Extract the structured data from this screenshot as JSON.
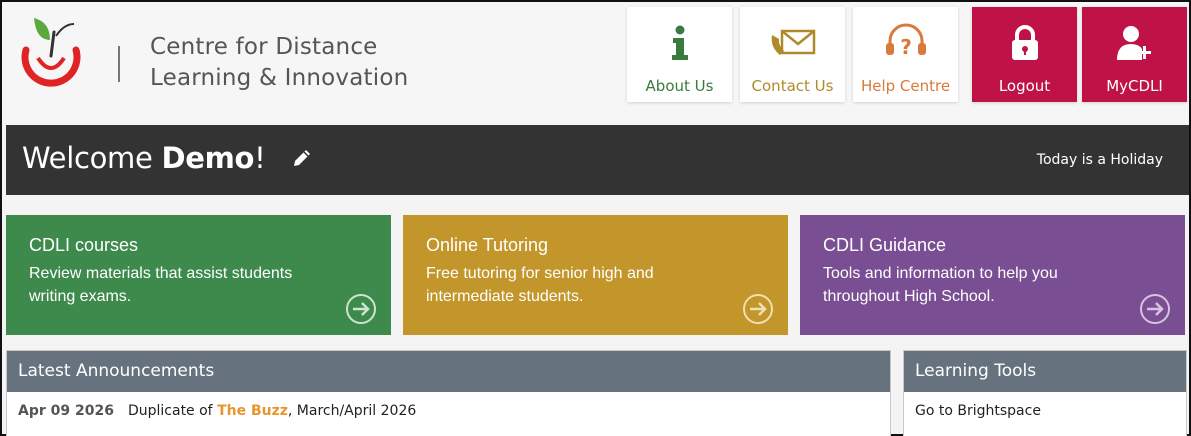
{
  "org": {
    "line1": "Centre for Distance",
    "line2": "Learning & Innovation"
  },
  "nav": [
    {
      "label": "About Us",
      "icon": "info-icon",
      "color": "#3b7a3e"
    },
    {
      "label": "Contact Us",
      "icon": "envelope-icon",
      "color": "#b08a2a"
    },
    {
      "label": "Help Centre",
      "icon": "headset-icon",
      "color": "#d9793a"
    },
    {
      "label": "Logout",
      "icon": "lock-icon",
      "color": "#ffffff"
    },
    {
      "label": "MyCDLI",
      "icon": "user-add-icon",
      "color": "#ffffff"
    }
  ],
  "welcome": {
    "prefix": "Welcome ",
    "name": "Demo",
    "suffix": "!",
    "status": "Today is a Holiday"
  },
  "promos": [
    {
      "title": "CDLI courses",
      "desc": "Review materials that assist students writing exams.",
      "color": "#3e8a4c"
    },
    {
      "title": "Online Tutoring",
      "desc": "Free tutoring for senior high and intermediate students.",
      "color": "#c2962a"
    },
    {
      "title": "CDLI Guidance",
      "desc": "Tools and information to help you throughout High School.",
      "color": "#7a4e93"
    }
  ],
  "announcements": {
    "title": "Latest Announcements",
    "items": [
      {
        "date": "Apr 09 2026",
        "prefix": "Duplicate of ",
        "link": "The Buzz",
        "suffix": ", March/April 2026"
      }
    ]
  },
  "tools": {
    "title": "Learning Tools",
    "items": [
      "Go to Brightspace"
    ]
  },
  "colors": {
    "brand_red": "#bf1348",
    "dark_bar": "#333333",
    "panel_head": "#66737f"
  }
}
